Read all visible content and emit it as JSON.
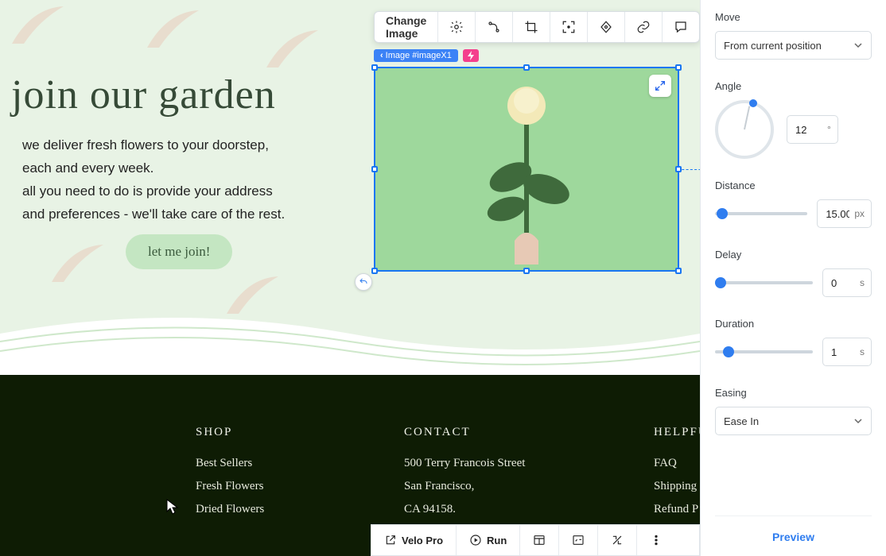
{
  "hero": {
    "title": "join our garden",
    "line1": "we deliver fresh flowers to your doorstep,",
    "line2": "each and every week.",
    "line3": "all you need to do is provide your address",
    "line4": "and preferences - we'll take care of the rest.",
    "button": "let me join!"
  },
  "selected_element": {
    "tag_prefix": "‹",
    "tag_label": "Image #imageX1"
  },
  "toolbar": {
    "change_image": "Change Image"
  },
  "footer": {
    "shop": {
      "heading": "SHOP",
      "items": [
        "Best Sellers",
        "Fresh Flowers",
        "Dried Flowers"
      ]
    },
    "contact": {
      "heading": "CONTACT",
      "addr1": "500 Terry Francois Street",
      "addr2": "San Francisco,",
      "addr3": "CA 94158."
    },
    "help": {
      "heading": "HELPFU",
      "items": [
        "FAQ",
        "Shipping",
        "Refund P"
      ]
    }
  },
  "panel": {
    "move": {
      "label": "Move",
      "value": "From current position"
    },
    "angle": {
      "label": "Angle",
      "value": "12",
      "unit": "°"
    },
    "distance": {
      "label": "Distance",
      "value": "15.00",
      "unit": "px",
      "slider_pct": 2
    },
    "delay": {
      "label": "Delay",
      "value": "0",
      "unit": "s",
      "slider_pct": 0
    },
    "duration": {
      "label": "Duration",
      "value": "1",
      "unit": "s",
      "slider_pct": 8
    },
    "easing": {
      "label": "Easing",
      "value": "Ease In"
    },
    "preview": "Preview"
  },
  "bottombar": {
    "velo": "Velo Pro",
    "run": "Run"
  }
}
